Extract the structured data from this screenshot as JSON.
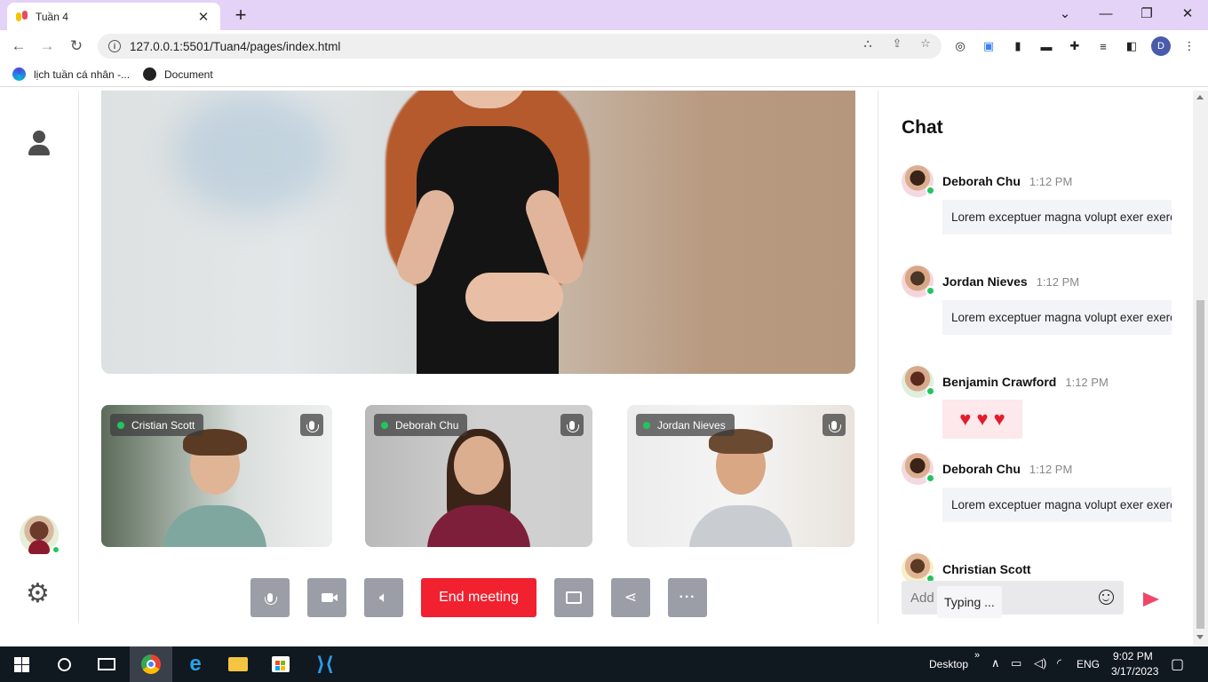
{
  "browser": {
    "tab_title": "Tuần 4",
    "url": "127.0.0.1:5501/Tuan4/pages/index.html",
    "profile_initial": "D",
    "bookmarks": [
      {
        "label": "lịch tuần cá nhân -..."
      },
      {
        "label": "Document"
      }
    ]
  },
  "meeting": {
    "participants": [
      {
        "name": "Cristian Scott"
      },
      {
        "name": "Deborah Chu"
      },
      {
        "name": "Jordan Nieves"
      }
    ],
    "controls": {
      "end_label": "End meeting"
    }
  },
  "chat": {
    "title": "Chat",
    "messages": [
      {
        "name": "Deborah Chu",
        "time": "1:12 PM",
        "text": "Lorem exceptuer magna volupt exer exercitation dolore exercitation ame"
      },
      {
        "name": "Jordan Nieves",
        "time": "1:12 PM",
        "text": "Lorem exceptuer magna volupt exer exercitation dolore exercitation ame"
      },
      {
        "name": "Benjamin Crawford",
        "time": "1:12 PM",
        "text": "♥ ♥ ♥"
      },
      {
        "name": "Deborah Chu",
        "time": "1:12 PM",
        "text": "Lorem exceptuer magna volupt exer exercitation dolore exercitation ame"
      },
      {
        "name": "Christian Scott",
        "time": "",
        "text": ""
      }
    ],
    "input_placeholder": "Add",
    "typing_label": "Typing ..."
  },
  "taskbar": {
    "desktop_label": "Desktop",
    "language": "ENG",
    "time": "9:02 PM",
    "date": "3/17/2023"
  },
  "colors": {
    "accent_red": "#f1212f",
    "send_pink": "#f0466b",
    "online_green": "#22c55e",
    "control_gray": "#9b9ea6",
    "tabstrip_purple": "#e5d2f7"
  }
}
